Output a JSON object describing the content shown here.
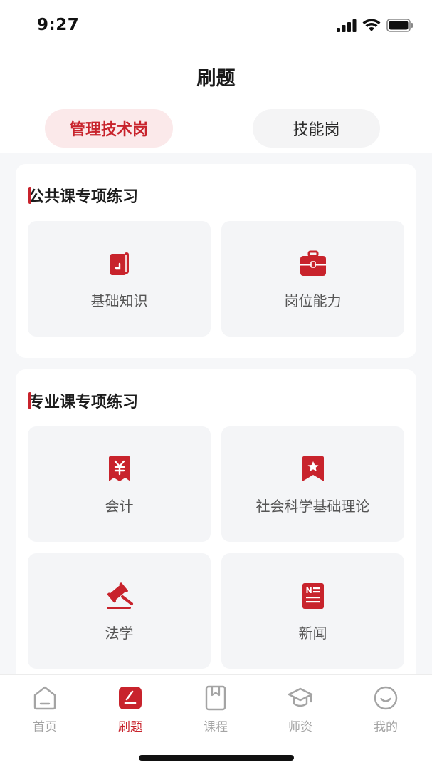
{
  "status_bar": {
    "time": "9:27"
  },
  "header": {
    "title": "刷题"
  },
  "segments": [
    {
      "label": "管理技术岗",
      "active": true
    },
    {
      "label": "技能岗",
      "active": false
    }
  ],
  "sections": [
    {
      "title": "公共课专项练习",
      "items": [
        {
          "label": "基础知识",
          "icon": "book-icon"
        },
        {
          "label": "岗位能力",
          "icon": "briefcase-icon"
        }
      ]
    },
    {
      "title": "专业课专项练习",
      "items": [
        {
          "label": "会计",
          "icon": "yen-receipt-icon"
        },
        {
          "label": "社会科学基础理论",
          "icon": "bookmark-star-icon"
        },
        {
          "label": "法学",
          "icon": "gavel-icon"
        },
        {
          "label": "新闻",
          "icon": "newspaper-icon"
        }
      ]
    }
  ],
  "tabbar": {
    "items": [
      {
        "label": "首页",
        "icon": "home-icon",
        "active": false
      },
      {
        "label": "刷题",
        "icon": "practice-icon",
        "active": true
      },
      {
        "label": "课程",
        "icon": "course-icon",
        "active": false
      },
      {
        "label": "师资",
        "icon": "graduation-cap-icon",
        "active": false
      },
      {
        "label": "我的",
        "icon": "smile-face-icon",
        "active": false
      }
    ]
  },
  "colors": {
    "accent": "#c8232c",
    "accent_bg": "#fbe9ea",
    "tile_bg": "#f4f5f7",
    "inactive_text": "#a4a4a4"
  }
}
